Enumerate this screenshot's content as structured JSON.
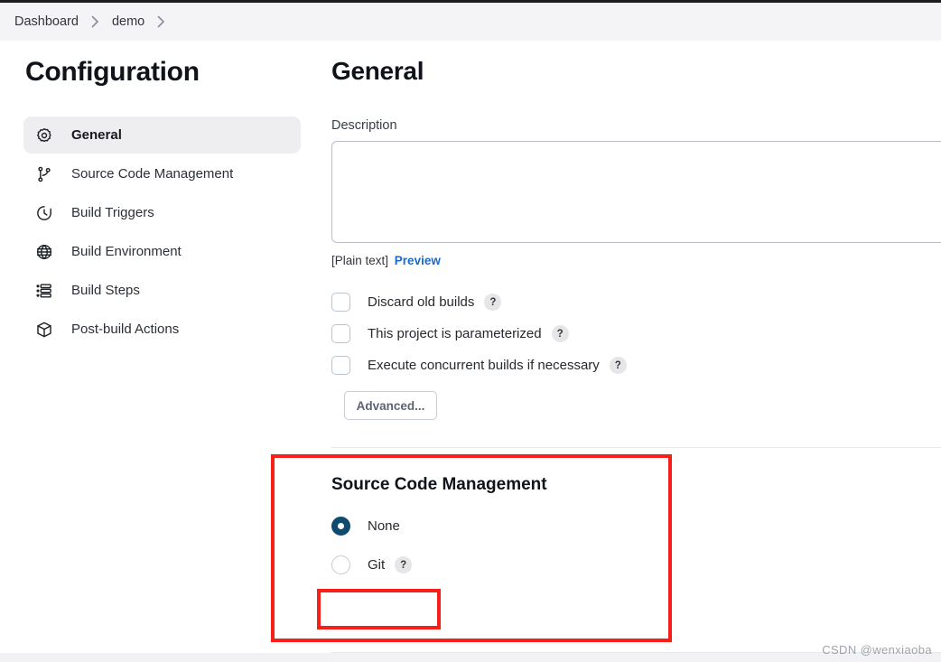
{
  "breadcrumb": {
    "items": [
      {
        "label": "Dashboard"
      },
      {
        "label": "demo"
      }
    ],
    "separator": "›"
  },
  "sidebar": {
    "title": "Configuration",
    "items": [
      {
        "label": "General",
        "icon": "gear-icon",
        "active": true
      },
      {
        "label": "Source Code Management",
        "icon": "git-branch-icon",
        "active": false
      },
      {
        "label": "Build Triggers",
        "icon": "clock-icon",
        "active": false
      },
      {
        "label": "Build Environment",
        "icon": "globe-icon",
        "active": false
      },
      {
        "label": "Build Steps",
        "icon": "list-icon",
        "active": false
      },
      {
        "label": "Post-build Actions",
        "icon": "package-icon",
        "active": false
      }
    ]
  },
  "main": {
    "title": "General",
    "description": {
      "label": "Description",
      "value": "",
      "placeholder": "",
      "markup_note": "[Plain text]",
      "preview_label": "Preview"
    },
    "checkboxes": [
      {
        "label": "Discard old builds",
        "checked": false,
        "help": "?"
      },
      {
        "label": "This project is parameterized",
        "checked": false,
        "help": "?"
      },
      {
        "label": "Execute concurrent builds if necessary",
        "checked": false,
        "help": "?"
      }
    ],
    "advanced_button": "Advanced...",
    "scm": {
      "title": "Source Code Management",
      "options": [
        {
          "label": "None",
          "selected": true,
          "help": null
        },
        {
          "label": "Git",
          "selected": false,
          "help": "?"
        }
      ]
    }
  },
  "annotations": {
    "color": "#f5201a",
    "boxes": [
      {
        "name": "scm-section-highlight"
      },
      {
        "name": "git-option-highlight"
      }
    ]
  },
  "watermark": "CSDN @wenxiaoba",
  "colors": {
    "accent_link": "#1b6ac9",
    "radio_selected": "#0f4b6e",
    "annotation_red": "#f5201a",
    "sidebar_active_bg": "#eeeef1",
    "breadcrumb_bg": "#f4f4f7"
  }
}
